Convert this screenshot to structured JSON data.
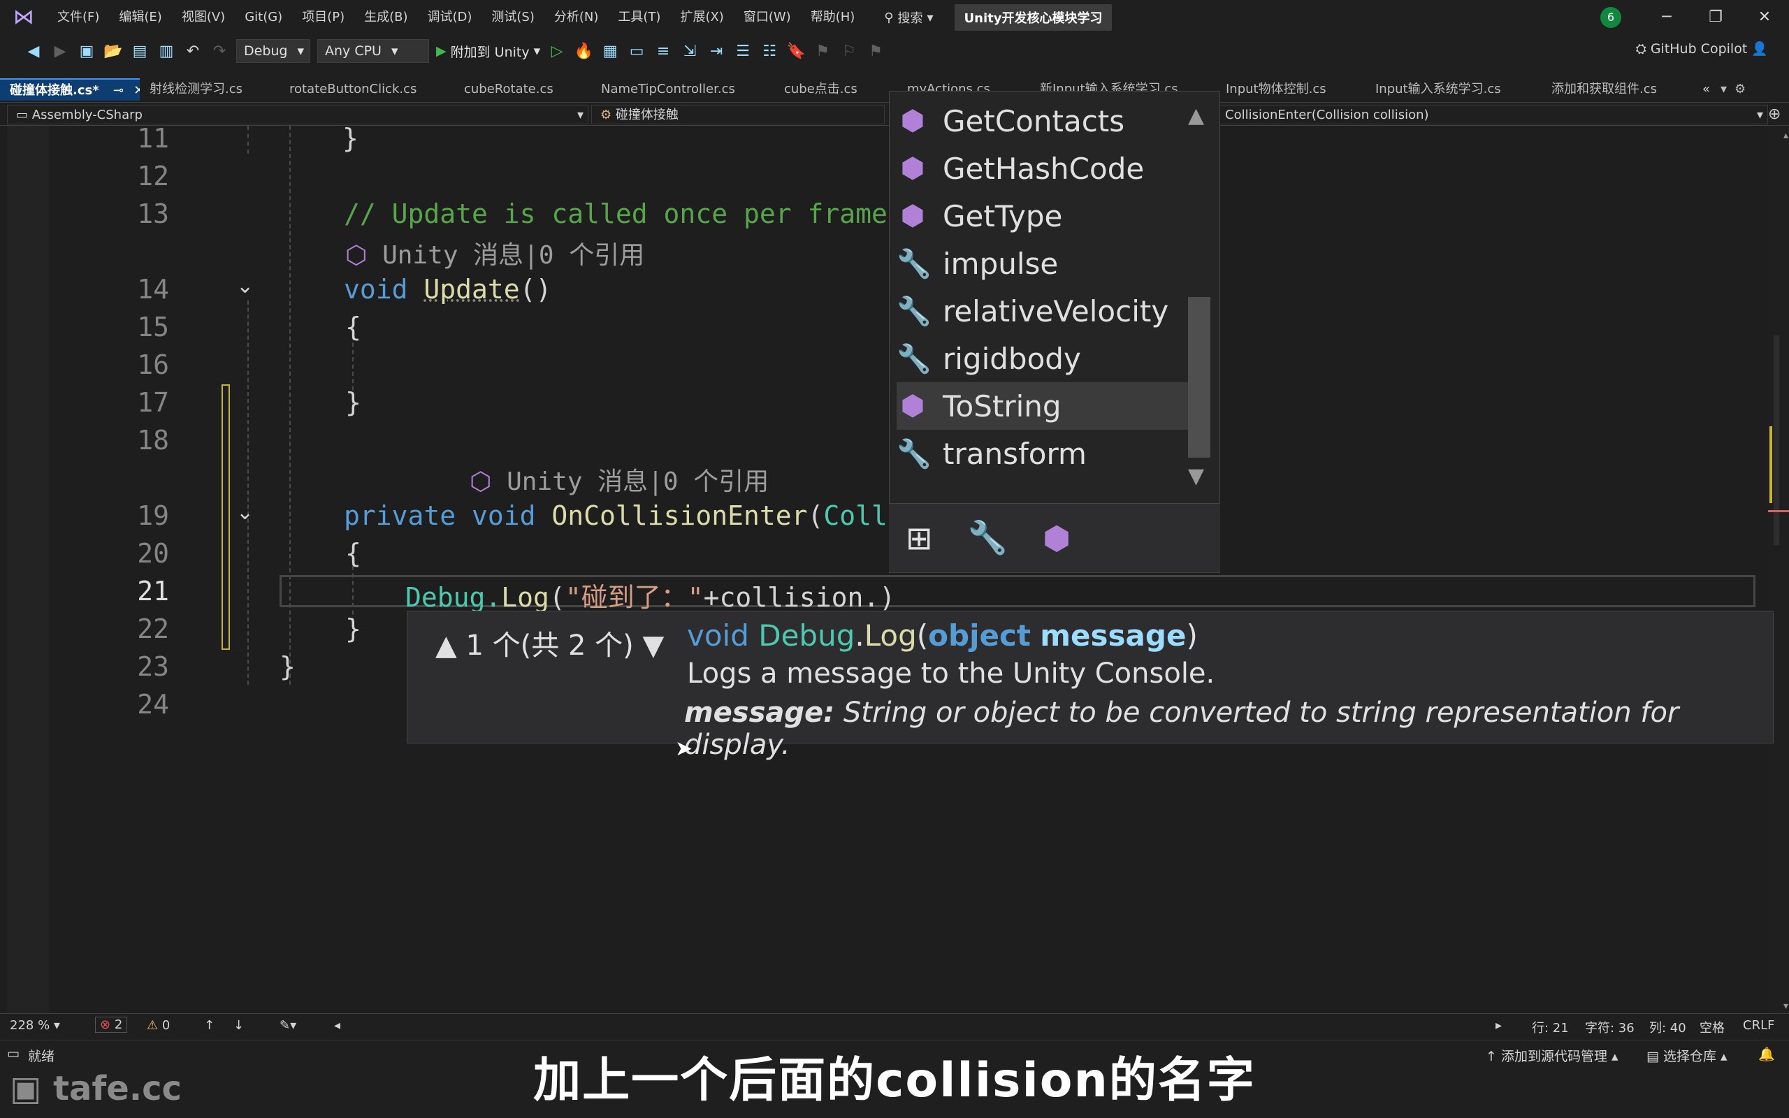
{
  "menubar": {
    "items": [
      "文件(F)",
      "编辑(E)",
      "视图(V)",
      "Git(G)",
      "项目(P)",
      "生成(B)",
      "调试(D)",
      "测试(S)",
      "分析(N)",
      "工具(T)",
      "扩展(X)",
      "窗口(W)",
      "帮助(H)"
    ],
    "search_label": "搜索",
    "solution_title": "Unity开发核心模块学习",
    "notification_count": "6"
  },
  "toolbar": {
    "config": "Debug",
    "platform": "Any CPU",
    "attach_label": "附加到 Unity",
    "copilot_label": "GitHub Copilot"
  },
  "tabs": [
    {
      "label": "碰撞体接触.cs*",
      "active": true
    },
    {
      "label": "射线检测学习.cs"
    },
    {
      "label": "rotateButtonClick.cs"
    },
    {
      "label": "cubeRotate.cs"
    },
    {
      "label": "NameTipController.cs"
    },
    {
      "label": "cube点击.cs"
    },
    {
      "label": "myActions.cs"
    },
    {
      "label": "新Input输入系统学习.cs"
    },
    {
      "label": "Input物体控制.cs"
    },
    {
      "label": "Input输入系统学习.cs"
    },
    {
      "label": "添加和获取组件.cs"
    }
  ],
  "navbar": {
    "project": "Assembly-CSharp",
    "class": "碰撞体接触",
    "member": "CollisionEnter(Collision collision)"
  },
  "editor": {
    "lines": [
      "11",
      "12",
      "13",
      "14",
      "15",
      "16",
      "17",
      "18",
      "19",
      "20",
      "21",
      "22",
      "23",
      "24"
    ],
    "current_line": "21",
    "comment": "// Update is called once per frame",
    "hint_unity": "Unity 消息|0 个引用",
    "update_sig": "void Update()",
    "collision_sig": "private void OnCollisionEnter(Colli",
    "current_code_prefix": "Debug.",
    "current_code_method": "Log",
    "current_code_str": "\"碰到了：\"",
    "current_code_suffix": "+collision.)"
  },
  "completion": {
    "items": [
      {
        "label": "GetContacts",
        "kind": "method"
      },
      {
        "label": "GetHashCode",
        "kind": "method"
      },
      {
        "label": "GetType",
        "kind": "method"
      },
      {
        "label": "impulse",
        "kind": "property"
      },
      {
        "label": "relativeVelocity",
        "kind": "property"
      },
      {
        "label": "rigidbody",
        "kind": "property"
      },
      {
        "label": "ToString",
        "kind": "method",
        "selected": true
      },
      {
        "label": "transform",
        "kind": "property"
      }
    ]
  },
  "signature_help": {
    "nav": "1 个(共 2 个)",
    "return_type": "void",
    "class_name": "Debug",
    "method_name": "Log",
    "param_type": "object",
    "param_name": "message",
    "description": "Logs a message to the Unity Console.",
    "param_label": "message:",
    "param_desc": "String or object to be converted to string representation for display."
  },
  "editor_status": {
    "zoom": "228 %",
    "errors": "2",
    "warnings": "0",
    "line": "行: 21",
    "char": "字符: 36",
    "col": "列: 40",
    "spacing": "空格",
    "eol": "CRLF"
  },
  "statusbar": {
    "ready": "就绪",
    "source_control": "添加到源代码管理",
    "repo": "选择仓库"
  },
  "subtitle": "加上一个后面的collision的名字",
  "watermark": "tafe.cc"
}
